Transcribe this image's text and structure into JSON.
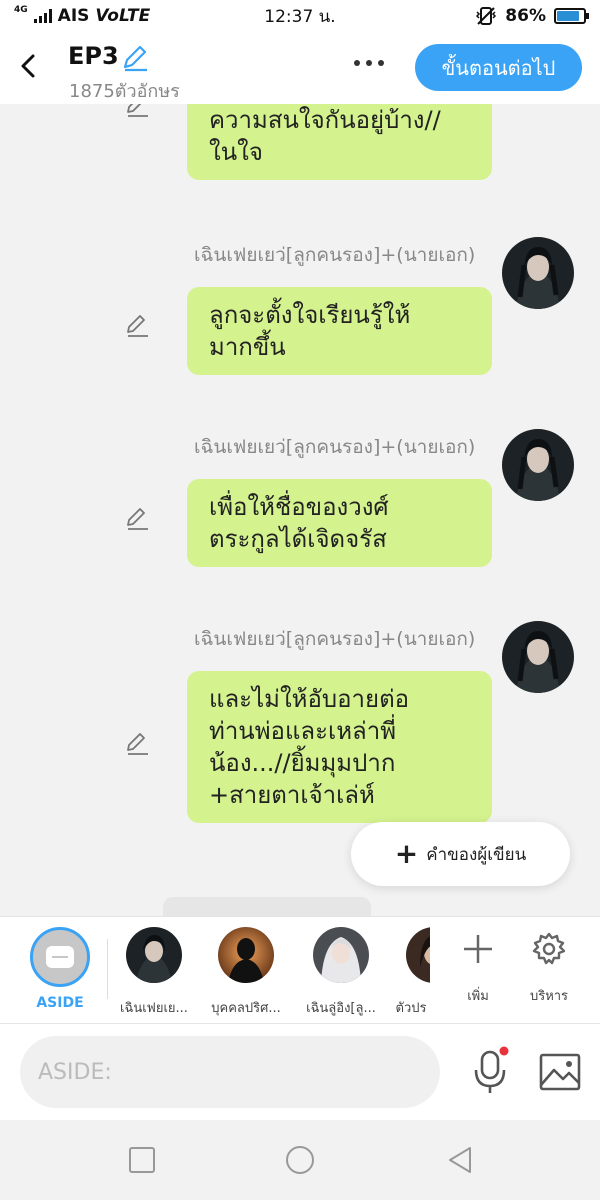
{
  "status_bar": {
    "network": "4G",
    "carrier": "AIS",
    "volte": "VoLTE",
    "time": "12:37 น.",
    "battery_percent": "86%",
    "battery_level": 0.86
  },
  "header": {
    "title": "EP3",
    "subtitle": "1875ตัวอักษร",
    "next_label": "ขั้นตอนต่อไป"
  },
  "chat": {
    "partial_message": "ความสนใจกันอยู่บ้าง//\nในใจ",
    "messages": [
      {
        "sender": "เฉินเฟยเยว่[ลูกคนรอง]+(นายเอก)",
        "text": "ลูกจะตั้งใจเรียนรู้ให้\nมากขึ้น"
      },
      {
        "sender": "เฉินเฟยเยว่[ลูกคนรอง]+(นายเอก)",
        "text": "เพื่อให้ชื่อของวงศ์\nตระกูลได้เจิดจรัส"
      },
      {
        "sender": "เฉินเฟยเยว่[ลูกคนรอง]+(นายเอก)",
        "text": "และไม่ให้อับอายต่อ\nท่านพ่อและเหล่าพี่\nน้อง...//ยิ้มมุมปาก\n+สายตาเจ้าเล่ห์"
      }
    ],
    "author_note_label": "คำของผู้เขียน"
  },
  "characters": {
    "aside_label": "ASIDE",
    "items": [
      {
        "label": "เฉินเฟยเย..."
      },
      {
        "label": "บุคคลปริศ..."
      },
      {
        "label": "เฉินลู่อิง[ลู..."
      },
      {
        "label": "ตัวปร"
      }
    ],
    "add_label": "เพิ่ม",
    "manage_label": "บริหาร"
  },
  "input": {
    "placeholder": "ASIDE:"
  },
  "colors": {
    "accent": "#3aa3f5",
    "bubble": "#d4f28e",
    "notification_dot": "#e8323c"
  }
}
